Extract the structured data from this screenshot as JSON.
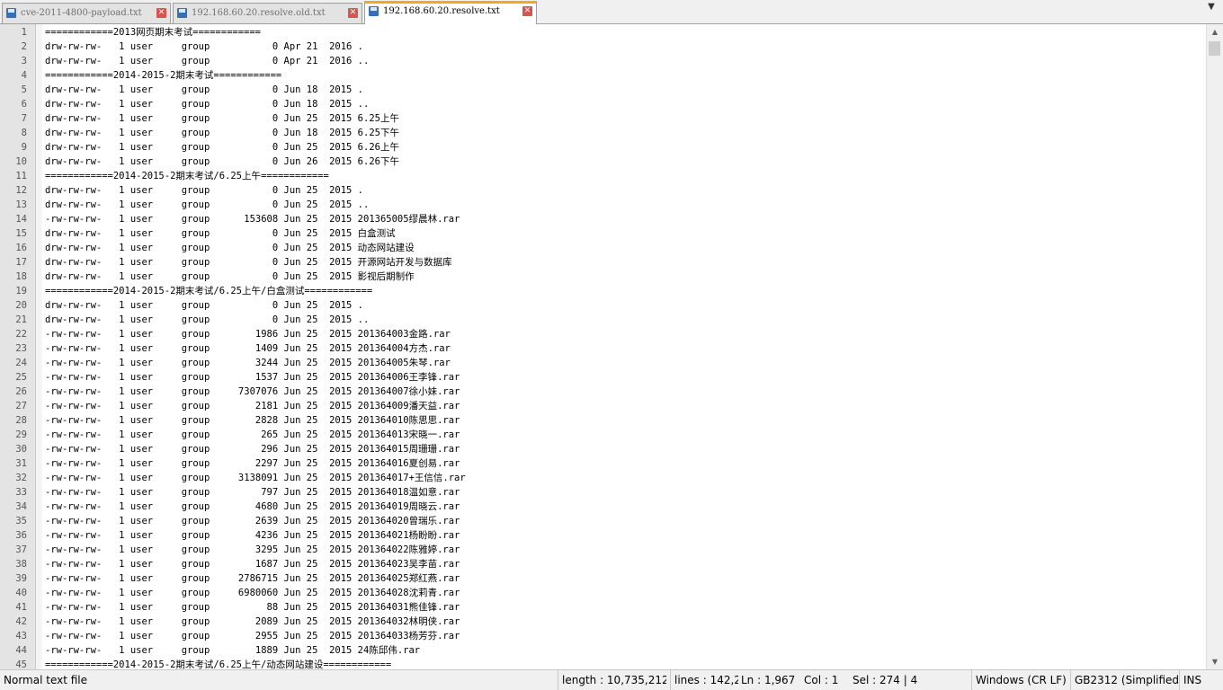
{
  "tabs": [
    {
      "label": "cve-2011-4800-payload.txt",
      "active": false
    },
    {
      "label": "192.168.60.20.resolve.old.txt",
      "active": false
    },
    {
      "label": "192.168.60.20.resolve.txt",
      "active": true
    }
  ],
  "tab_menu_icon": "▼",
  "close_glyph": "✕",
  "scrollbar": {
    "up": "▲",
    "down": "▼"
  },
  "lines": [
    {
      "n": "1",
      "t": "============2013网页期末考试============"
    },
    {
      "n": "2",
      "t": "drw-rw-rw-   1 user     group           0 Apr 21  2016 ."
    },
    {
      "n": "3",
      "t": "drw-rw-rw-   1 user     group           0 Apr 21  2016 .."
    },
    {
      "n": "4",
      "t": "============2014-2015-2期末考试============"
    },
    {
      "n": "5",
      "t": "drw-rw-rw-   1 user     group           0 Jun 18  2015 ."
    },
    {
      "n": "6",
      "t": "drw-rw-rw-   1 user     group           0 Jun 18  2015 .."
    },
    {
      "n": "7",
      "t": "drw-rw-rw-   1 user     group           0 Jun 25  2015 6.25上午"
    },
    {
      "n": "8",
      "t": "drw-rw-rw-   1 user     group           0 Jun 18  2015 6.25下午"
    },
    {
      "n": "9",
      "t": "drw-rw-rw-   1 user     group           0 Jun 25  2015 6.26上午"
    },
    {
      "n": "10",
      "t": "drw-rw-rw-   1 user     group           0 Jun 26  2015 6.26下午"
    },
    {
      "n": "11",
      "t": "============2014-2015-2期末考试/6.25上午============"
    },
    {
      "n": "12",
      "t": "drw-rw-rw-   1 user     group           0 Jun 25  2015 ."
    },
    {
      "n": "13",
      "t": "drw-rw-rw-   1 user     group           0 Jun 25  2015 .."
    },
    {
      "n": "14",
      "t": "-rw-rw-rw-   1 user     group      153608 Jun 25  2015 201365005缪晨林.rar"
    },
    {
      "n": "15",
      "t": "drw-rw-rw-   1 user     group           0 Jun 25  2015 白盒测试"
    },
    {
      "n": "16",
      "t": "drw-rw-rw-   1 user     group           0 Jun 25  2015 动态网站建设"
    },
    {
      "n": "17",
      "t": "drw-rw-rw-   1 user     group           0 Jun 25  2015 开源网站开发与数据库"
    },
    {
      "n": "18",
      "t": "drw-rw-rw-   1 user     group           0 Jun 25  2015 影视后期制作"
    },
    {
      "n": "19",
      "t": "============2014-2015-2期末考试/6.25上午/白盒测试============"
    },
    {
      "n": "20",
      "t": "drw-rw-rw-   1 user     group           0 Jun 25  2015 ."
    },
    {
      "n": "21",
      "t": "drw-rw-rw-   1 user     group           0 Jun 25  2015 .."
    },
    {
      "n": "22",
      "t": "-rw-rw-rw-   1 user     group        1986 Jun 25  2015 201364003金路.rar"
    },
    {
      "n": "23",
      "t": "-rw-rw-rw-   1 user     group        1409 Jun 25  2015 201364004方杰.rar"
    },
    {
      "n": "24",
      "t": "-rw-rw-rw-   1 user     group        3244 Jun 25  2015 201364005朱琴.rar"
    },
    {
      "n": "25",
      "t": "-rw-rw-rw-   1 user     group        1537 Jun 25  2015 201364006王李锋.rar"
    },
    {
      "n": "26",
      "t": "-rw-rw-rw-   1 user     group     7307076 Jun 25  2015 201364007徐小妹.rar"
    },
    {
      "n": "27",
      "t": "-rw-rw-rw-   1 user     group        2181 Jun 25  2015 201364009潘天益.rar"
    },
    {
      "n": "28",
      "t": "-rw-rw-rw-   1 user     group        2828 Jun 25  2015 201364010陈思思.rar"
    },
    {
      "n": "29",
      "t": "-rw-rw-rw-   1 user     group         265 Jun 25  2015 201364013宋晓一.rar"
    },
    {
      "n": "30",
      "t": "-rw-rw-rw-   1 user     group         296 Jun 25  2015 201364015周珊珊.rar"
    },
    {
      "n": "31",
      "t": "-rw-rw-rw-   1 user     group        2297 Jun 25  2015 201364016夏创易.rar"
    },
    {
      "n": "32",
      "t": "-rw-rw-rw-   1 user     group     3138091 Jun 25  2015 201364017+王信信.rar"
    },
    {
      "n": "33",
      "t": "-rw-rw-rw-   1 user     group         797 Jun 25  2015 201364018温如意.rar"
    },
    {
      "n": "34",
      "t": "-rw-rw-rw-   1 user     group        4680 Jun 25  2015 201364019周晓云.rar"
    },
    {
      "n": "35",
      "t": "-rw-rw-rw-   1 user     group        2639 Jun 25  2015 201364020曾瑞乐.rar"
    },
    {
      "n": "36",
      "t": "-rw-rw-rw-   1 user     group        4236 Jun 25  2015 201364021杨盼盼.rar"
    },
    {
      "n": "37",
      "t": "-rw-rw-rw-   1 user     group        3295 Jun 25  2015 201364022陈雅婷.rar"
    },
    {
      "n": "38",
      "t": "-rw-rw-rw-   1 user     group        1687 Jun 25  2015 201364023吴李苗.rar"
    },
    {
      "n": "39",
      "t": "-rw-rw-rw-   1 user     group     2786715 Jun 25  2015 201364025郑红燕.rar"
    },
    {
      "n": "40",
      "t": "-rw-rw-rw-   1 user     group     6980060 Jun 25  2015 201364028沈莉青.rar"
    },
    {
      "n": "41",
      "t": "-rw-rw-rw-   1 user     group          88 Jun 25  2015 201364031熊佳锋.rar"
    },
    {
      "n": "42",
      "t": "-rw-rw-rw-   1 user     group        2089 Jun 25  2015 201364032林明侠.rar"
    },
    {
      "n": "43",
      "t": "-rw-rw-rw-   1 user     group        2955 Jun 25  2015 201364033杨芳芬.rar"
    },
    {
      "n": "44",
      "t": "-rw-rw-rw-   1 user     group        1889 Jun 25  2015 24陈邱伟.rar"
    },
    {
      "n": "45",
      "t": "============2014-2015-2期末考试/6.25上午/动态网站建设============"
    }
  ],
  "status": {
    "file_type": "Normal text file",
    "length": "length : 10,735,212",
    "lines": "lines : 142,2",
    "ln": "Ln : 1,967",
    "col": "Col : 1",
    "sel": "Sel : 274 | 4",
    "eol": "Windows (CR LF)",
    "encoding": "GB2312 (Simplified)",
    "mode": "INS"
  }
}
